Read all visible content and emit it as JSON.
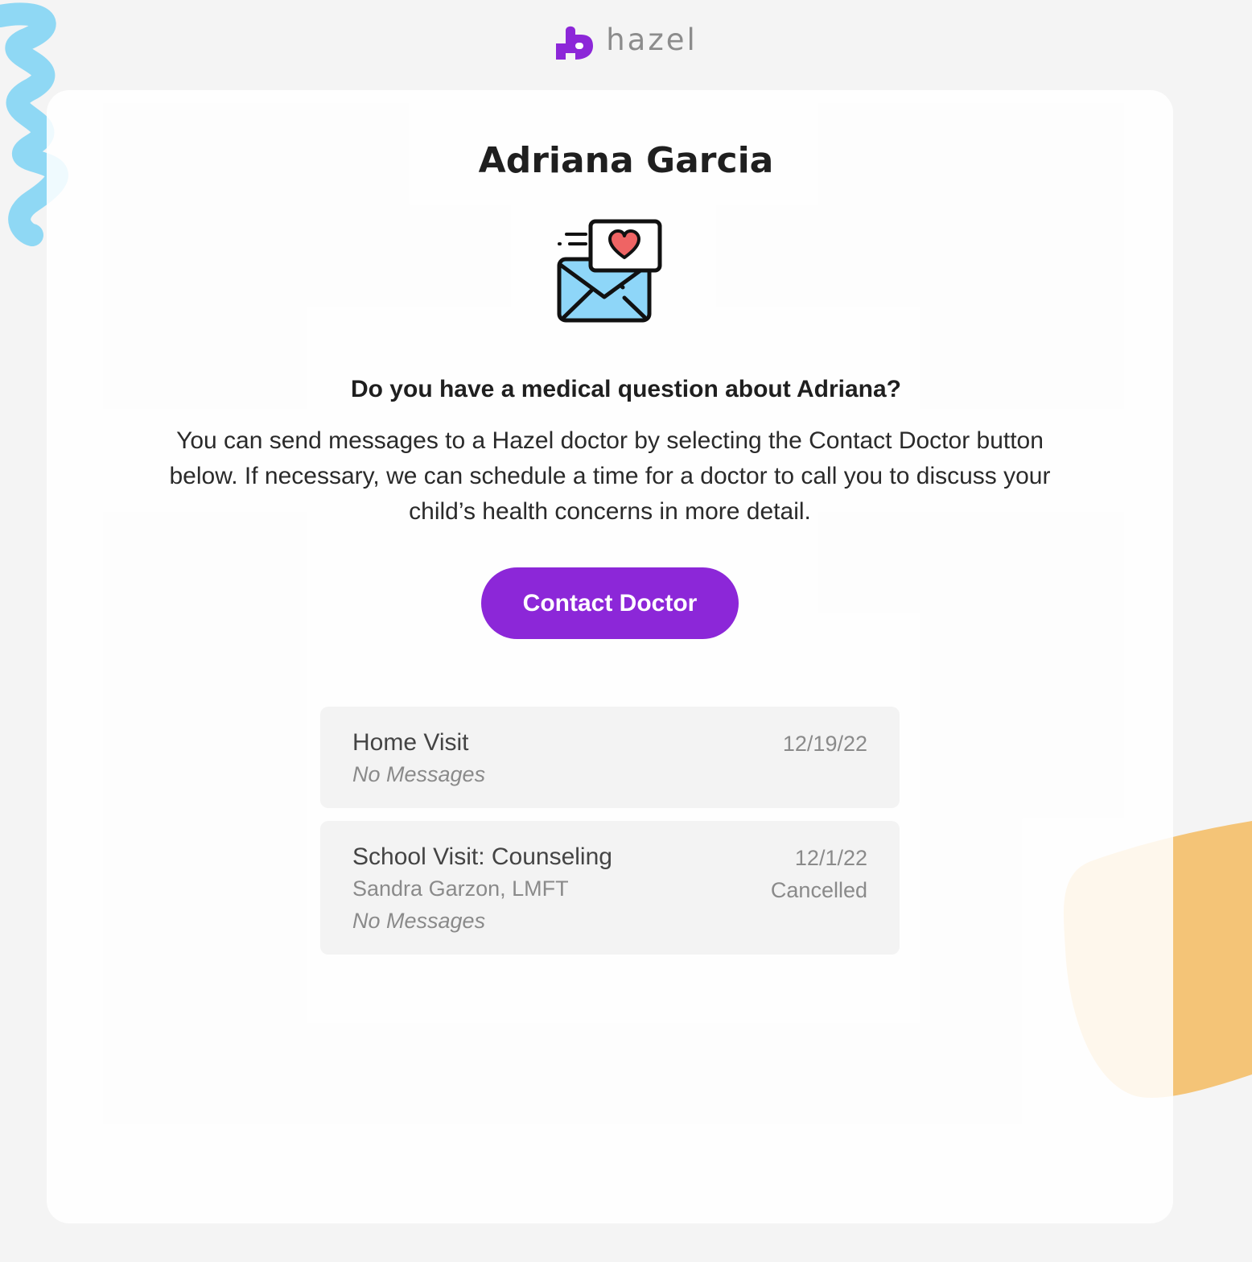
{
  "brand": {
    "name": "hazel",
    "logo_icon": "hazel-plus-heart-icon",
    "accent_color": "#8c27d8"
  },
  "patient": {
    "name": "Adriana Garcia"
  },
  "illustration": {
    "icon": "envelope-heart-message-icon"
  },
  "question": {
    "heading": "Do you have a medical question about Adriana?",
    "description": "You can send messages to a Hazel doctor by selecting the Contact Doctor button below. If necessary, we can schedule a time for a doctor to call you to discuss your child’s health concerns in more detail."
  },
  "actions": {
    "contact_label": "Contact Doctor"
  },
  "visits": [
    {
      "title": "Home Visit",
      "provider": "",
      "messages": "No Messages",
      "date": "12/19/22",
      "status": ""
    },
    {
      "title": "School Visit: Counseling",
      "provider": "Sandra Garzon, LMFT",
      "messages": "No Messages",
      "date": "12/1/22",
      "status": "Cancelled"
    }
  ],
  "decor": {
    "left_scribble_color": "#8fd8f4",
    "right_blob_color": "#f4c477"
  }
}
